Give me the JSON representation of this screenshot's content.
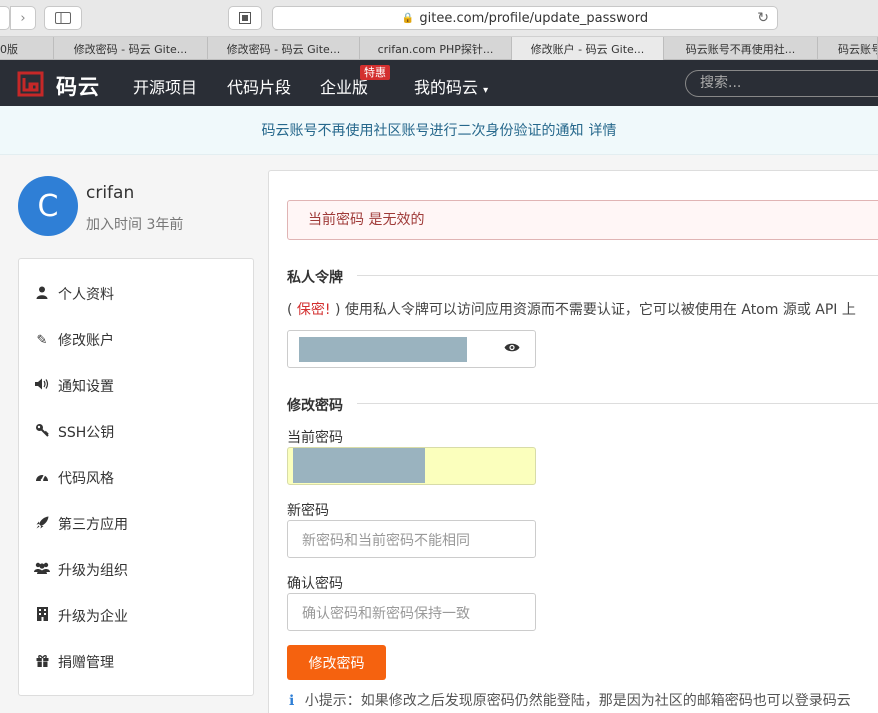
{
  "browser": {
    "url": "gitee.com/profile/update_password",
    "tabs": [
      {
        "label": "0版"
      },
      {
        "label": "修改密码 - 码云 Gite..."
      },
      {
        "label": "修改密码 - 码云 Gite..."
      },
      {
        "label": "crifan.com PHP探针..."
      },
      {
        "label": "修改账户 - 码云 Gite...",
        "active": true
      },
      {
        "label": "码云账号不再使用社..."
      },
      {
        "label": "码云账号"
      }
    ]
  },
  "navbar": {
    "brand": "码云",
    "items": [
      "开源项目",
      "代码片段",
      "企业版",
      "我的码云"
    ],
    "badge": "特惠",
    "search_placeholder": "搜索..."
  },
  "notice": {
    "text": "码云账号不再使用社区账号进行二次身份验证的通知",
    "link": "详情"
  },
  "profile": {
    "avatar_letter": "C",
    "username": "crifan",
    "joined": "加入时间 3年前"
  },
  "sidebar": {
    "items": [
      {
        "label": "个人资料",
        "icon": "user-icon"
      },
      {
        "label": "修改账户",
        "icon": "pencil-icon"
      },
      {
        "label": "通知设置",
        "icon": "volume-icon"
      },
      {
        "label": "SSH公钥",
        "icon": "key-icon"
      },
      {
        "label": "代码风格",
        "icon": "dashboard-icon"
      },
      {
        "label": "第三方应用",
        "icon": "rocket-icon"
      },
      {
        "label": "升级为组织",
        "icon": "users-icon"
      },
      {
        "label": "升级为企业",
        "icon": "building-icon"
      },
      {
        "label": "捐赠管理",
        "icon": "gift-icon"
      }
    ]
  },
  "main": {
    "error": "当前密码 是无效的",
    "token_section": "私人令牌",
    "token_desc_open": "(",
    "token_desc_secret": "保密!",
    "token_desc_rest": ") 使用私人令牌可以访问应用资源而不需要认证，它可以被使用在 Atom 源或 API 上",
    "password_section": "修改密码",
    "current_label": "当前密码",
    "new_label": "新密码",
    "new_placeholder": "新密码和当前密码不能相同",
    "confirm_label": "确认密码",
    "confirm_placeholder": "确认密码和新密码保持一致",
    "submit": "修改密码",
    "tip": "小提示：如果修改之后发现原密码仍然能登陆，那是因为社区的邮箱密码也可以登录码云"
  },
  "colors": {
    "navbar_bg": "#2a2e36",
    "brand_red": "#c62828",
    "submit_orange": "#f5620f",
    "notice_text": "#26688c",
    "error_text": "#9f3a38"
  }
}
